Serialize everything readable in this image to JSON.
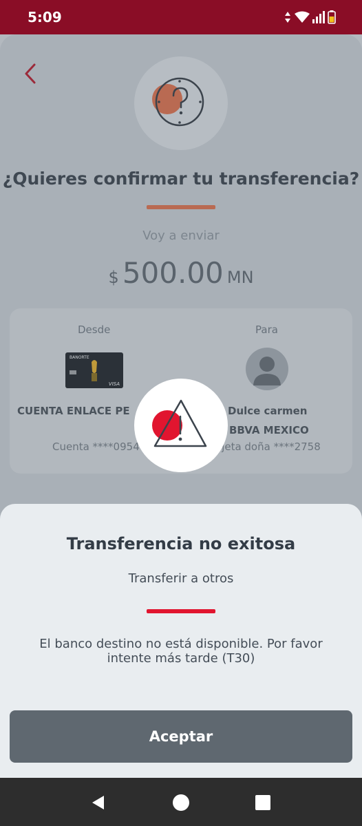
{
  "status_bar": {
    "time": "5:09",
    "icons": [
      "data-arrows-icon",
      "wifi-icon",
      "signal-icon",
      "battery-icon"
    ],
    "background": "#8a0d26"
  },
  "confirm_screen": {
    "title": "¿Quieres confirmar tu transferencia?",
    "send_label": "Voy a enviar",
    "amount": {
      "currency": "$",
      "value": "500.00",
      "unit": "MN"
    },
    "accent_color": "#b96a52",
    "from": {
      "label": "Desde",
      "card_brand": "BANORTE",
      "card_network": "VISA",
      "account_name": "CUENTA ENLACE PE",
      "account_number": "Cuenta ****0954"
    },
    "to": {
      "label": "Para",
      "name": "Dulce carmen",
      "bank": "BBVA MEXICO",
      "account": "rjeta doña ****2758"
    }
  },
  "error_sheet": {
    "title": "Transferencia no exitosa",
    "subtitle": "Transferir a otros",
    "message": "El banco destino no está disponible. Por favor intente más tarde (T30)",
    "accept_label": "Aceptar",
    "accent_color": "#e1152f",
    "button_color": "#5f6870"
  },
  "nav_bar": {
    "buttons": [
      "back-icon",
      "home-icon",
      "recents-icon"
    ]
  }
}
